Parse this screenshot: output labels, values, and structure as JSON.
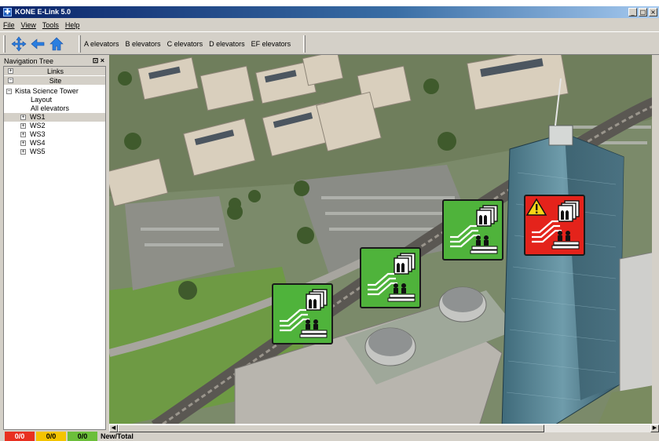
{
  "window": {
    "title": "KONE E-Link 5.0"
  },
  "menu": [
    "File",
    "View",
    "Tools",
    "Help"
  ],
  "toolbar": {
    "icons": [
      "move-icon",
      "back-arrow-icon",
      "home-icon"
    ],
    "items": [
      "A elevators",
      "B elevators",
      "C elevators",
      "D elevators",
      "EF elevators"
    ]
  },
  "nav": {
    "header": "Navigation Tree",
    "controls": "â° Ã",
    "sections": {
      "links": "Links",
      "site": "Site"
    },
    "tree": {
      "root": "Kista Science Tower",
      "layout": "Layout",
      "all_elevators": "All elevators",
      "groups": [
        "WS1",
        "WS2",
        "WS3",
        "WS4",
        "WS5"
      ]
    }
  },
  "status": {
    "red": "0/0",
    "yellow": "0/0",
    "green": "0/0",
    "label": "New/Total",
    "colors": {
      "red": "#e83020",
      "yellow": "#f4c400",
      "green": "#6cbf3a"
    }
  },
  "elevators": [
    {
      "id": "ws-group-1",
      "status": "ok",
      "color": "#4fb33b"
    },
    {
      "id": "ws-group-2",
      "status": "ok",
      "color": "#4fb33b"
    },
    {
      "id": "ws-group-3",
      "status": "ok",
      "color": "#4fb33b"
    },
    {
      "id": "ws-group-4",
      "status": "warning",
      "color": "#e4231b"
    }
  ]
}
